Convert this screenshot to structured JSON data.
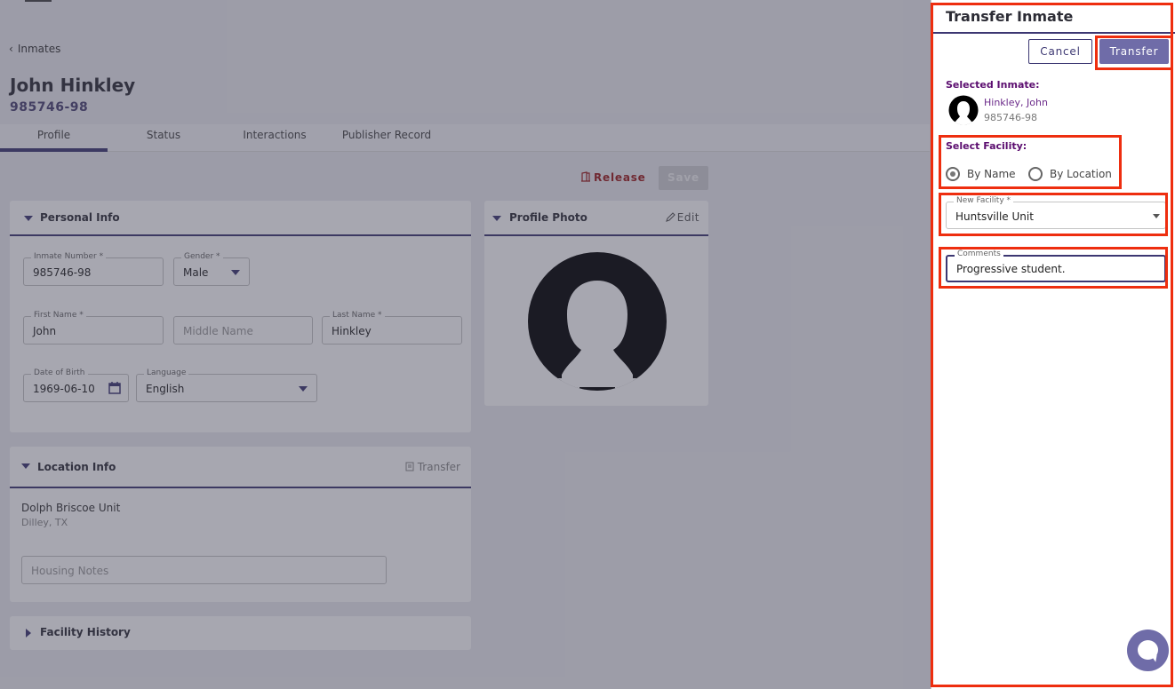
{
  "breadcrumb": {
    "back_label": "Inmates"
  },
  "inmate": {
    "full_name": "John Hinkley",
    "number": "985746-98"
  },
  "tabs": [
    {
      "label": "Profile"
    },
    {
      "label": "Status"
    },
    {
      "label": "Interactions"
    },
    {
      "label": "Publisher Record"
    }
  ],
  "actions": {
    "release_label": "Release",
    "save_label": "Save"
  },
  "personal_info": {
    "title": "Personal Info",
    "inmate_number": {
      "label": "Inmate Number *",
      "value": "985746-98"
    },
    "gender": {
      "label": "Gender *",
      "value": "Male"
    },
    "first_name": {
      "label": "First Name *",
      "value": "John"
    },
    "middle_name": {
      "placeholder": "Middle Name"
    },
    "last_name": {
      "label": "Last Name *",
      "value": "Hinkley"
    },
    "dob": {
      "label": "Date of Birth",
      "value": "1969-06-10"
    },
    "language": {
      "label": "Language",
      "value": "English"
    }
  },
  "profile_photo": {
    "title": "Profile Photo",
    "edit_label": "Edit"
  },
  "location_info": {
    "title": "Location Info",
    "transfer_label": "Transfer",
    "facility": "Dolph Briscoe Unit",
    "city": "Dilley, TX",
    "housing_placeholder": "Housing Notes"
  },
  "facility_history": {
    "title": "Facility History"
  },
  "drawer": {
    "title": "Transfer Inmate",
    "cancel_label": "Cancel",
    "transfer_label": "Transfer",
    "selected_label": "Selected Inmate:",
    "selected_name": "Hinkley, John",
    "selected_number": "985746-98",
    "facility_label": "Select Facility:",
    "radio_by_name": "By Name",
    "radio_by_location": "By Location",
    "selected_radio": "By Name",
    "new_facility": {
      "label": "New Facility *",
      "value": "Huntsville Unit"
    },
    "comments": {
      "label": "Comments",
      "value": "Progressive student."
    }
  },
  "colors": {
    "accent": "#3c3772",
    "button": "#6f6ca8",
    "highlight": "#ee2e0f",
    "label_purple": "#5b0d6f"
  }
}
